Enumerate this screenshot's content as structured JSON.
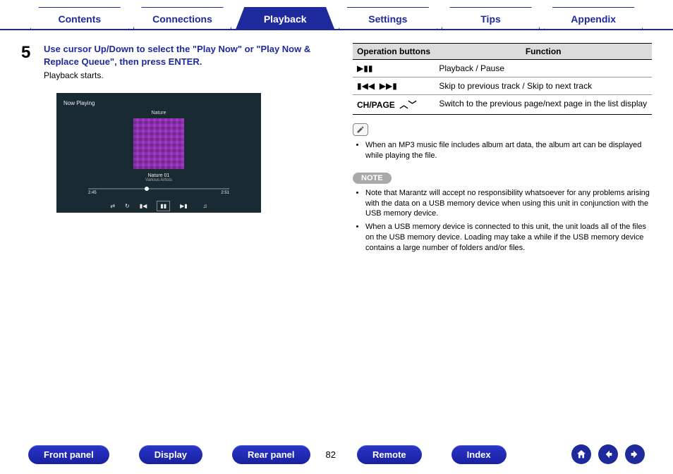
{
  "tabs": {
    "items": [
      {
        "label": "Contents"
      },
      {
        "label": "Connections"
      },
      {
        "label": "Playback"
      },
      {
        "label": "Settings"
      },
      {
        "label": "Tips"
      },
      {
        "label": "Appendix"
      }
    ],
    "active_index": 2
  },
  "step": {
    "number": "5",
    "heading": "Use cursor Up/Down to select the \"Play Now\" or \"Play Now & Replace Queue\", then press ENTER.",
    "sub": "Playback starts."
  },
  "now_playing": {
    "header": "Now Playing",
    "category": "Nature",
    "track_title": "Nature 01",
    "track_artist": "Various Artists",
    "time_elapsed": "2:45",
    "time_total": "2:51",
    "controls": {
      "shuffle": "shuffle",
      "repeat": "repeat",
      "prev": "prev",
      "pause": "pause",
      "next": "next",
      "queue": "queue"
    }
  },
  "table": {
    "headers": {
      "left": "Operation buttons",
      "right": "Function"
    },
    "rows": [
      {
        "left_type": "icon",
        "left": "play-pause-icon",
        "right": "Playback / Pause"
      },
      {
        "left_type": "icon",
        "left": "skip-icons",
        "right": "Skip to previous track / Skip to next track"
      },
      {
        "left_type": "text",
        "left": "CH/PAGE",
        "left_suffix": "chev",
        "right": "Switch to the previous page/next page in the list display"
      }
    ]
  },
  "info_bullets": [
    "When an MP3 music file includes album art data, the album art can be displayed while playing the file."
  ],
  "note": {
    "label": "NOTE",
    "bullets": [
      "Note that Marantz will accept no responsibility whatsoever for any problems arising with the data on a USB memory device when using this unit in conjunction with the USB memory device.",
      "When a USB memory device is connected to this unit, the unit loads all of the files on the USB memory device. Loading may take a while if the USB memory device contains a large number of folders and/or files."
    ]
  },
  "bottom_nav": {
    "pills": [
      "Front panel",
      "Display",
      "Rear panel",
      "Remote",
      "Index"
    ],
    "page": "82"
  }
}
